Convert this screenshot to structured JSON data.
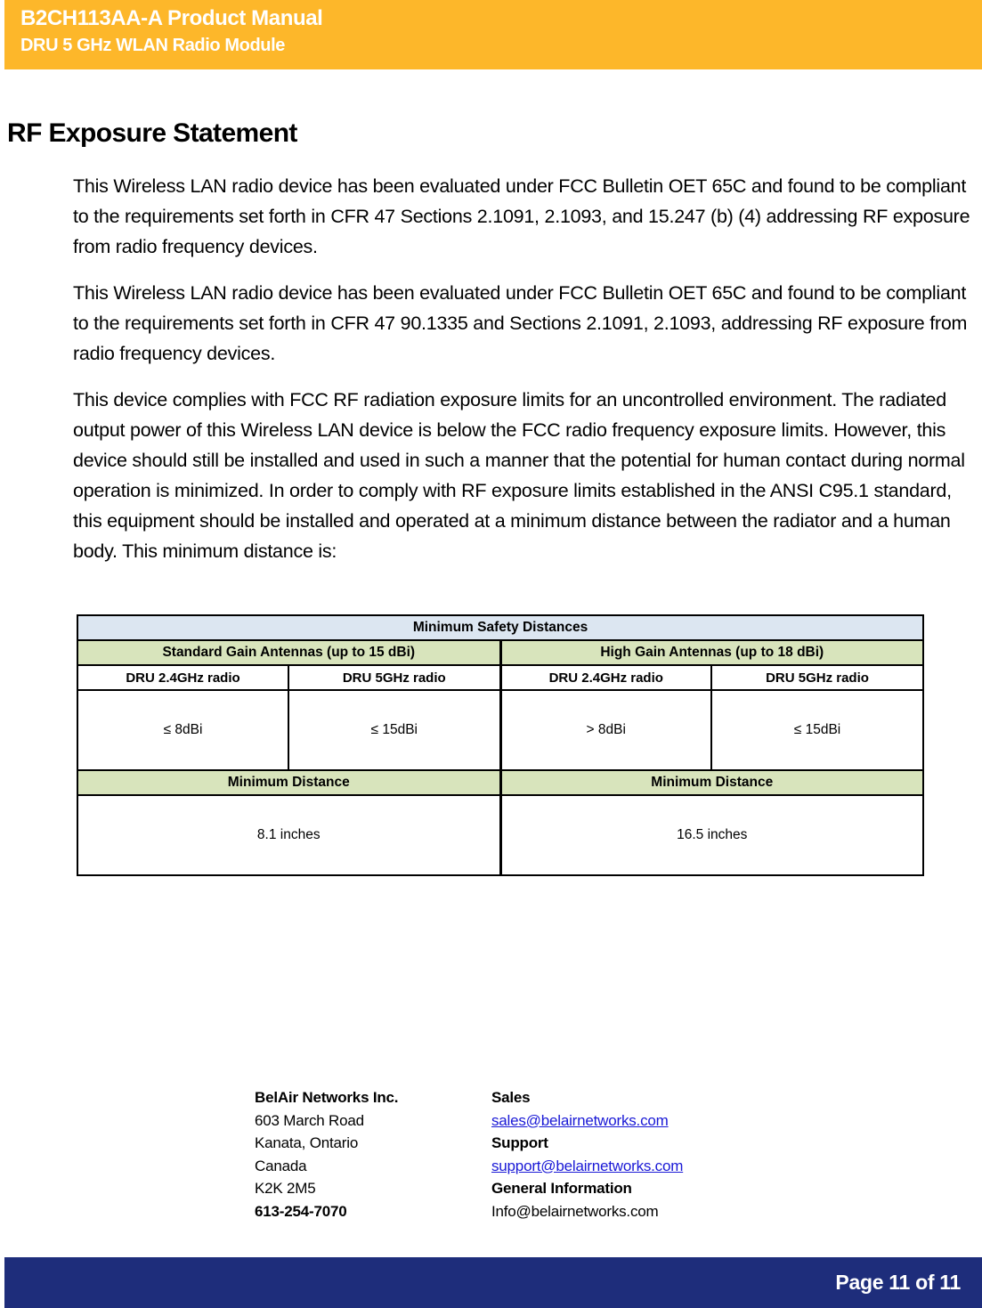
{
  "header": {
    "title": "B2CH113AA-A Product Manual",
    "subtitle": "DRU 5 GHz WLAN Radio Module",
    "background_color": "#FDB72A"
  },
  "section": {
    "heading": "RF Exposure Statement"
  },
  "paragraphs": [
    "This Wireless LAN radio device has been evaluated under FCC Bulletin OET 65C and found to be compliant to the requirements set forth in CFR 47 Sections 2.1091, 2.1093, and 15.247 (b) (4) addressing RF exposure from radio frequency devices.",
    "This Wireless LAN radio device has been evaluated under FCC Bulletin OET 65C and found to be compliant to the requirements set forth in CFR 47  90.1335 and Sections 2.1091, 2.1093, addressing RF exposure from radio frequency devices.",
    "This device complies with FCC RF radiation exposure limits for an uncontrolled environment.  The radiated output power of this Wireless LAN device is below the FCC radio frequency exposure limits.  However, this device should still be installed and used in such a manner that the potential for human contact during normal operation is minimized.  In order to comply with RF exposure limits established in the ANSI C95.1 standard, this equipment should be installed and operated at a minimum distance between the radiator and a human body.  This minimum distance is:"
  ],
  "table": {
    "title": "Minimum Safety Distances",
    "title_background": "#DCE6F1",
    "group_background": "#D8E4BC",
    "groups": [
      "Standard Gain Antennas (up to 15 dBi)",
      "High Gain Antennas (up to 18 dBi)"
    ],
    "radio_headers": [
      "DRU 2.4GHz radio",
      "DRU 5GHz radio",
      "DRU 2.4GHz radio",
      "DRU 5GHz radio"
    ],
    "gain_values": [
      "≤ 8dBi",
      "≤ 15dBi",
      "> 8dBi",
      "≤ 15dBi"
    ],
    "distance_labels": [
      "Minimum Distance",
      "Minimum Distance"
    ],
    "distance_values": [
      "8.1 inches",
      "16.5 inches"
    ]
  },
  "contact": {
    "left": [
      {
        "text": "BelAir Networks Inc.",
        "bold": true,
        "link": false
      },
      {
        "text": "603 March Road",
        "bold": false,
        "link": false
      },
      {
        "text": "Kanata, Ontario",
        "bold": false,
        "link": false
      },
      {
        "text": "Canada",
        "bold": false,
        "link": false
      },
      {
        "text": "K2K 2M5",
        "bold": false,
        "link": false
      },
      {
        "text": "613-254-7070",
        "bold": true,
        "link": false
      }
    ],
    "right": [
      {
        "text": "Sales",
        "bold": true,
        "link": false
      },
      {
        "text": "sales@belairnetworks.com",
        "bold": false,
        "link": true
      },
      {
        "text": "Support",
        "bold": true,
        "link": false
      },
      {
        "text": "support@belairnetworks.com",
        "bold": false,
        "link": true
      },
      {
        "text": "General Information",
        "bold": true,
        "link": false
      },
      {
        "text": "Info@belairnetworks.com",
        "bold": false,
        "link": false
      }
    ],
    "link_color": "#1a19d6"
  },
  "footer": {
    "page_label": "Page 11 of 11",
    "background_color": "#1E2D7B"
  }
}
